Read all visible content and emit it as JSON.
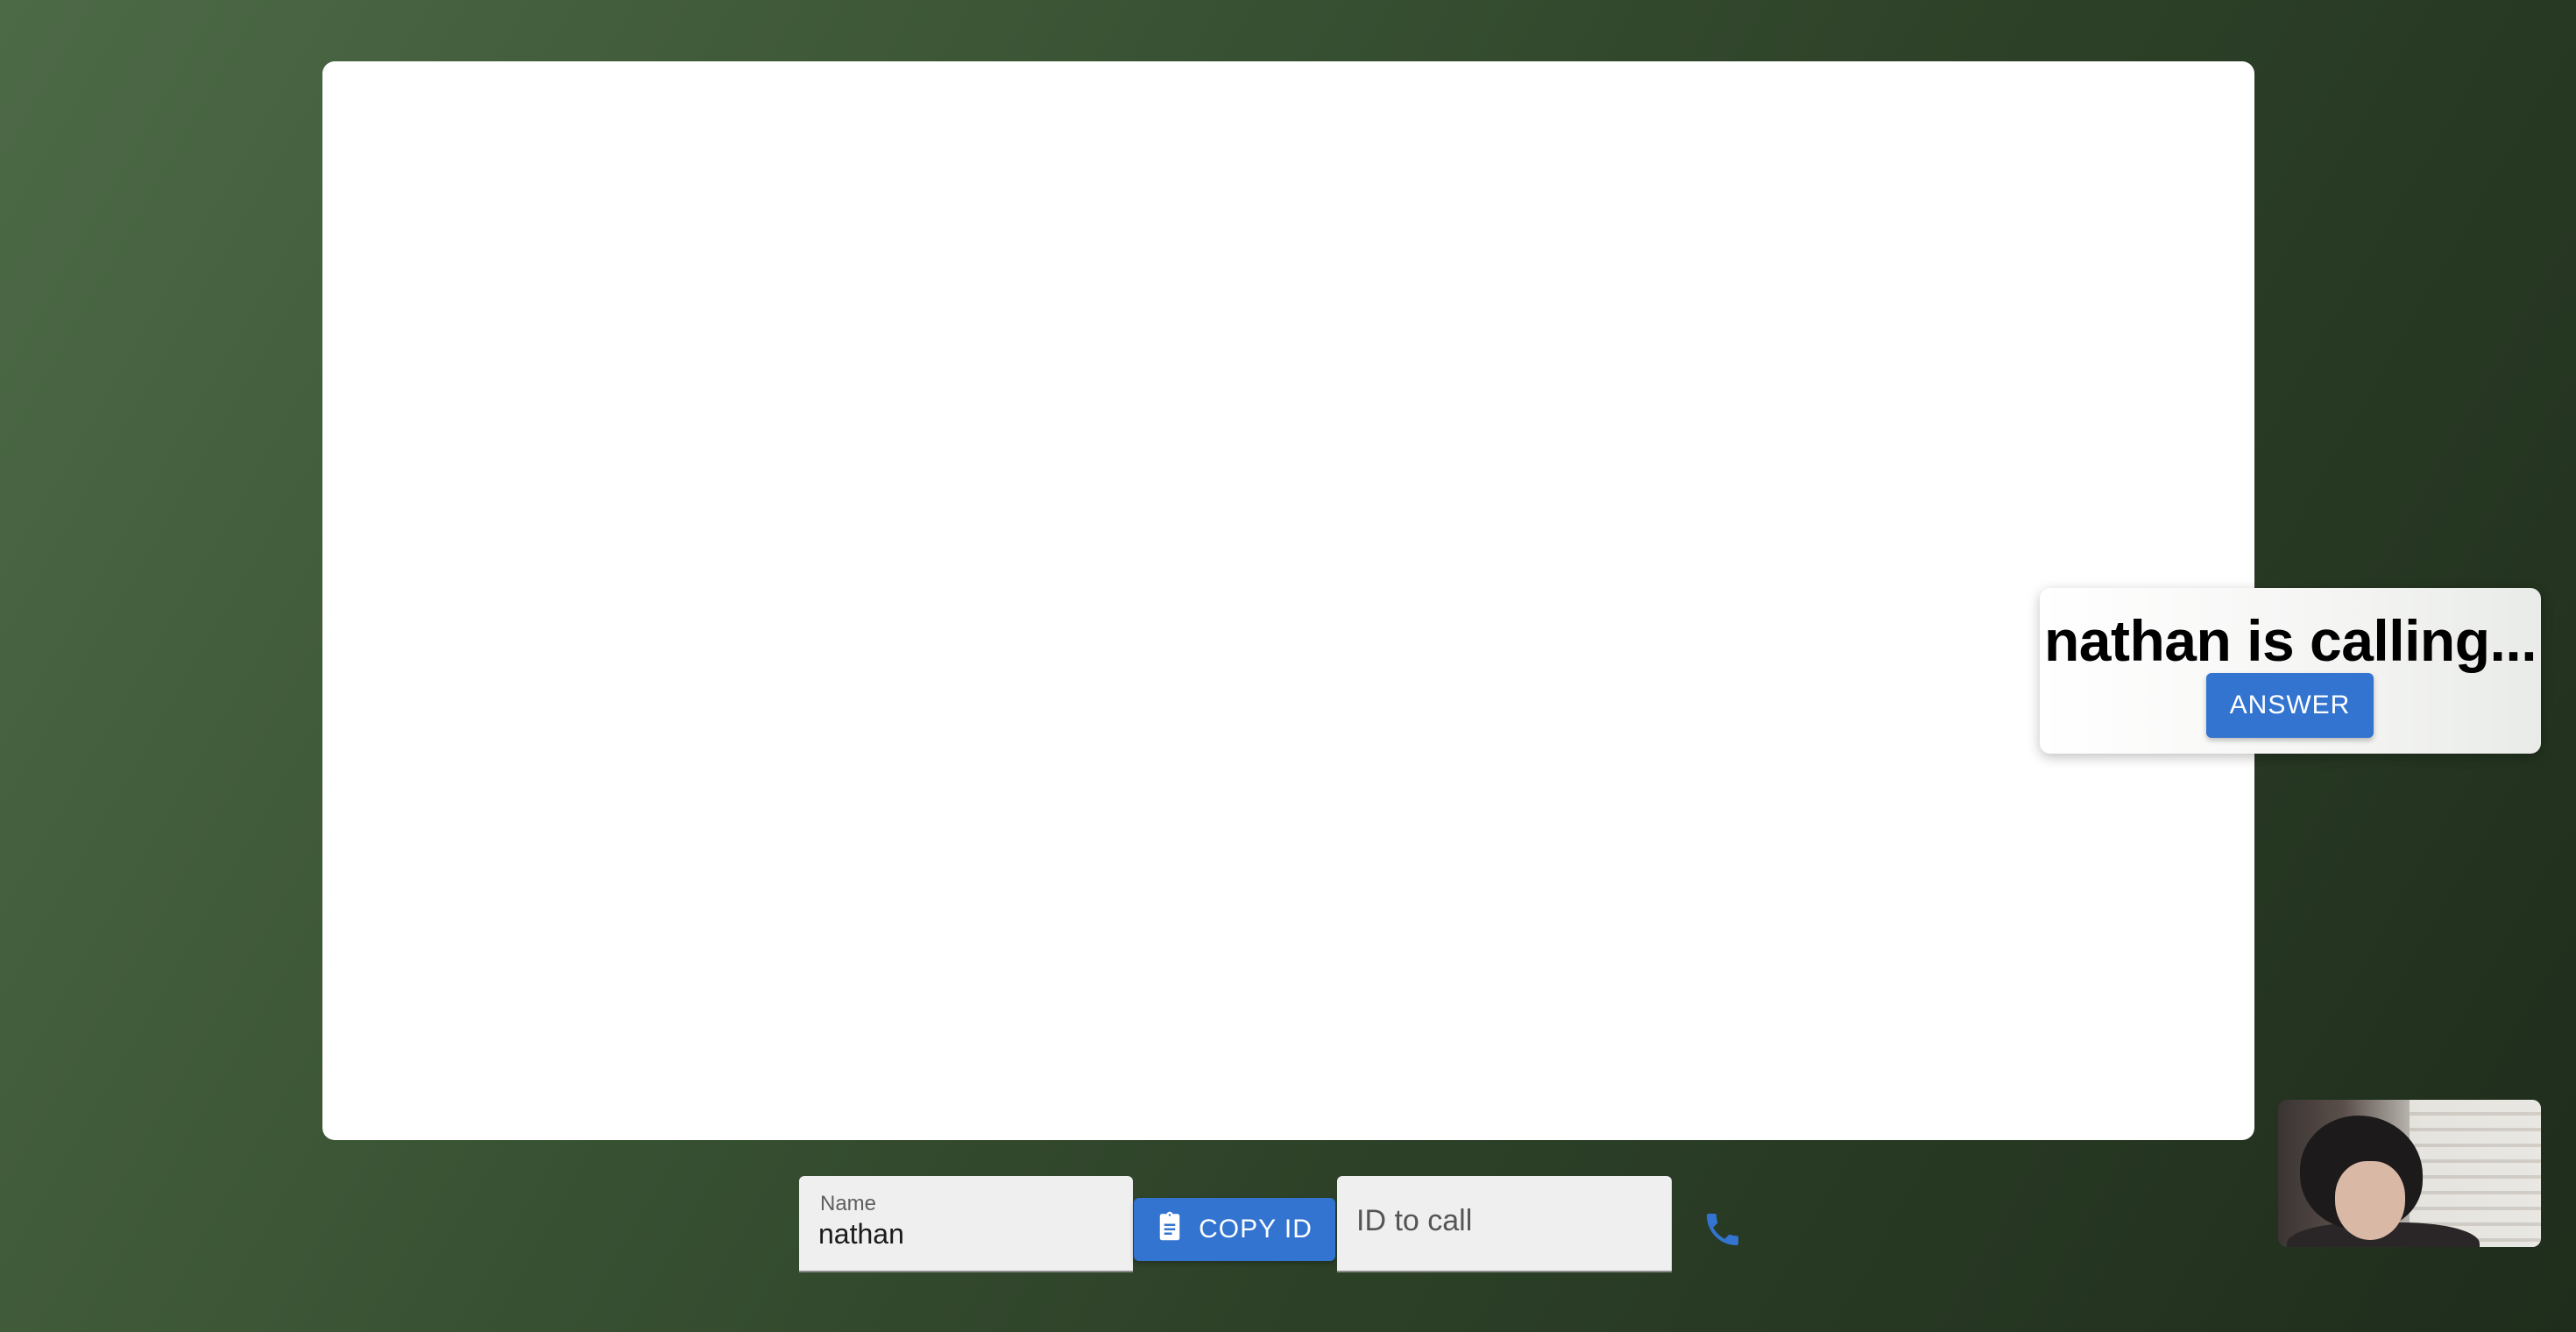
{
  "incoming_call": {
    "title": "nathan is calling...",
    "answer_label": "ANSWER"
  },
  "form": {
    "name_label": "Name",
    "name_value": "nathan",
    "copy_id_label": "COPY ID",
    "id_to_call_placeholder": "ID to call",
    "id_to_call_value": ""
  },
  "icons": {
    "copy": "clipboard-icon",
    "call": "phone-icon"
  },
  "colors": {
    "accent": "#3374d1",
    "background": "#3c5636",
    "stage": "#ffffff"
  }
}
